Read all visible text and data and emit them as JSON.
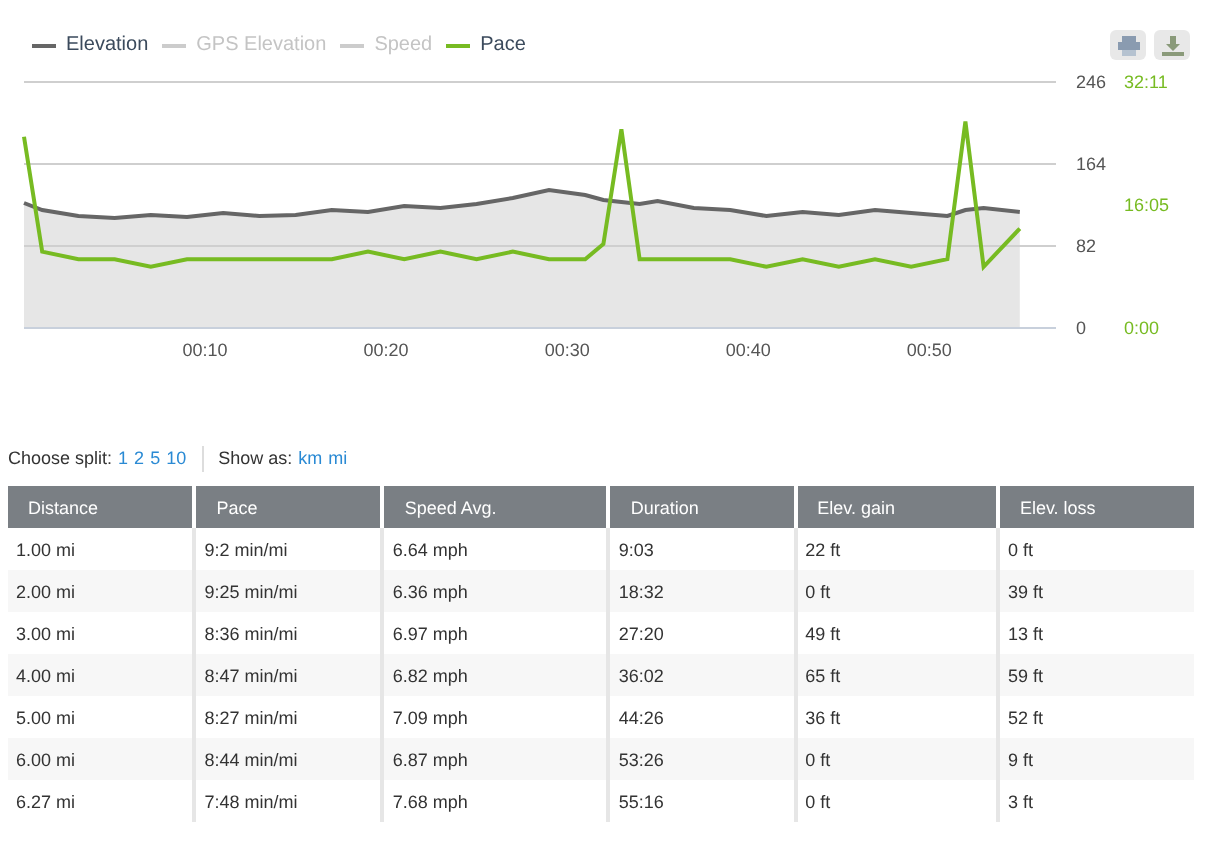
{
  "legend": [
    {
      "kind": "series",
      "active": true
    },
    {
      "kind": "other",
      "label": "GPS Elevation",
      "color": "#cccccc",
      "active": false
    },
    {
      "kind": "other",
      "label": "Speed",
      "color": "#cccccc",
      "active": false
    },
    {
      "kind": "series",
      "active": true
    }
  ],
  "chart": {
    "chart_data": {
      "type": "line",
      "x": [
        0,
        1,
        3,
        5,
        7,
        9,
        11,
        13,
        15,
        17,
        19,
        21,
        23,
        25,
        27,
        29,
        31,
        32,
        33,
        34,
        35,
        37,
        39,
        41,
        43,
        45,
        47,
        49,
        51,
        52,
        53,
        55
      ],
      "xlim": [
        0,
        57
      ],
      "xticks": [
        {
          "value": 10,
          "label": "00:10"
        },
        {
          "value": 20,
          "label": "00:20"
        },
        {
          "value": 30,
          "label": "00:30"
        },
        {
          "value": 40,
          "label": "00:40"
        },
        {
          "value": 50,
          "label": "00:50"
        }
      ],
      "ylim": [
        0,
        246
      ],
      "yticks": [
        {
          "value": 0,
          "label": "0"
        },
        {
          "value": 82,
          "label": "82"
        },
        {
          "value": 164,
          "label": "164"
        },
        {
          "value": 246,
          "label": "246"
        }
      ],
      "y2lim": [
        0,
        32.18
      ],
      "y2ticks": [
        {
          "value": 0,
          "label": "0:00"
        },
        {
          "value": 16.08,
          "label": "16:05"
        },
        {
          "value": 32.18,
          "label": "32:11"
        }
      ],
      "series": [
        {
          "name": "Elevation",
          "color": "#666666",
          "values": [
            125,
            118,
            112,
            110,
            113,
            111,
            115,
            112,
            113,
            118,
            116,
            122,
            120,
            124,
            130,
            138,
            133,
            128,
            126,
            124,
            127,
            120,
            118,
            112,
            116,
            113,
            118,
            115,
            112,
            118,
            120,
            116
          ]
        },
        {
          "name": "Pace",
          "color": "#77bb22",
          "axis": "y2",
          "values": [
            25,
            10,
            9,
            9,
            8,
            9,
            9,
            9,
            9,
            9,
            10,
            9,
            10,
            9,
            10,
            9,
            9,
            11,
            26,
            9,
            9,
            9,
            9,
            8,
            9,
            8,
            9,
            8,
            9,
            27,
            8,
            13
          ]
        }
      ]
    }
  },
  "split": {
    "label": "Choose split:",
    "options": [
      {
        "label": "1"
      },
      {
        "label": "2"
      },
      {
        "label": "5"
      },
      {
        "label": "10"
      }
    ]
  },
  "units": {
    "label": "Show as:",
    "options": [
      {
        "label": "km"
      },
      {
        "label": "mi"
      }
    ]
  },
  "table": {
    "columns": [
      "Distance",
      "Pace",
      "Speed Avg.",
      "Duration",
      "Elev. gain",
      "Elev. loss"
    ],
    "rows": [
      [
        "1.00 mi",
        "9:2 min/mi",
        "6.64 mph",
        "9:03",
        "22 ft",
        "0 ft"
      ],
      [
        "2.00 mi",
        "9:25 min/mi",
        "6.36 mph",
        "18:32",
        "0 ft",
        "39 ft"
      ],
      [
        "3.00 mi",
        "8:36 min/mi",
        "6.97 mph",
        "27:20",
        "49 ft",
        "13 ft"
      ],
      [
        "4.00 mi",
        "8:47 min/mi",
        "6.82 mph",
        "36:02",
        "65 ft",
        "59 ft"
      ],
      [
        "5.00 mi",
        "8:27 min/mi",
        "7.09 mph",
        "44:26",
        "36 ft",
        "52 ft"
      ],
      [
        "6.00 mi",
        "8:44 min/mi",
        "6.87 mph",
        "53:26",
        "0 ft",
        "9 ft"
      ],
      [
        "6.27 mi",
        "7:48 min/mi",
        "7.68 mph",
        "55:16",
        "0 ft",
        "3 ft"
      ]
    ]
  }
}
